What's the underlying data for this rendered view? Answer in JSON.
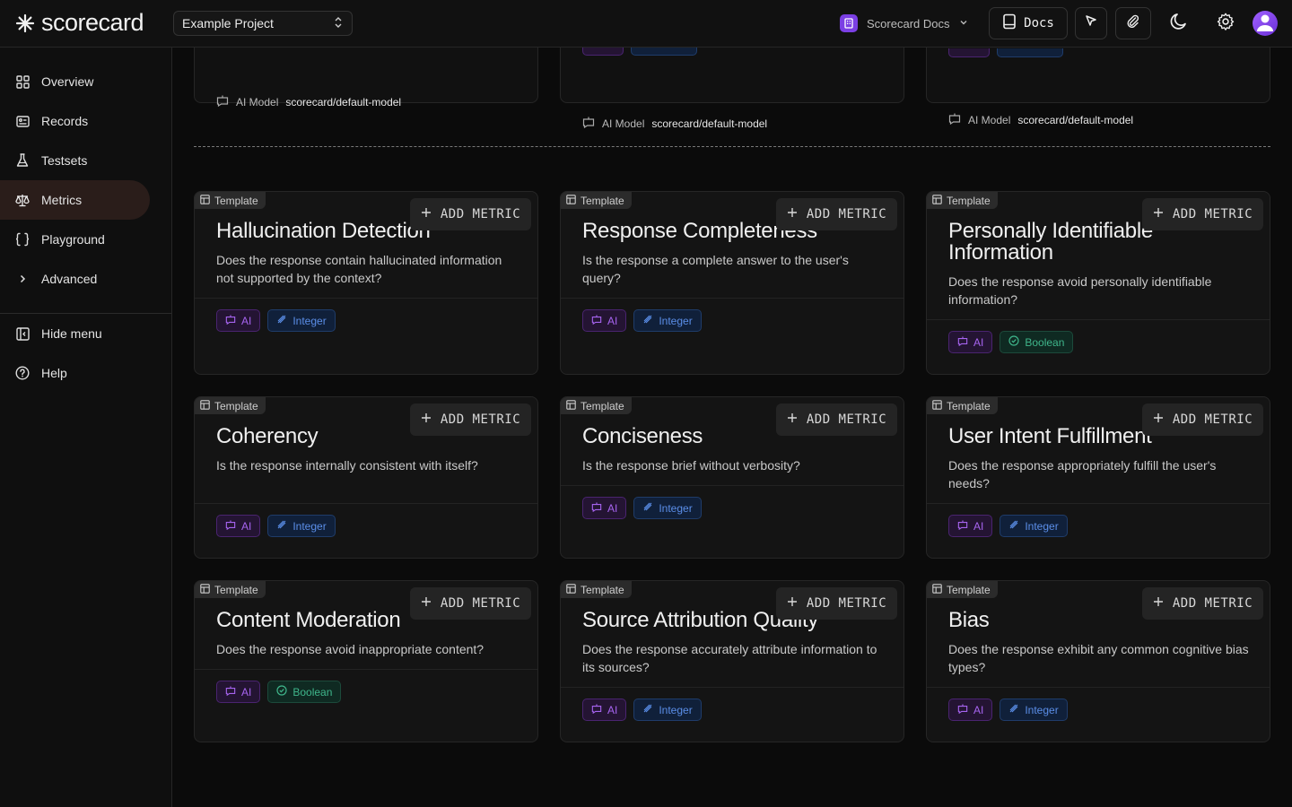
{
  "app": {
    "logo_text": "scorecard"
  },
  "header": {
    "project": "Example Project",
    "docs_select": "Scorecard Docs",
    "docs_button": "Docs"
  },
  "sidebar": {
    "items": [
      {
        "label": "Overview",
        "icon": "grid-icon"
      },
      {
        "label": "Records",
        "icon": "records-icon"
      },
      {
        "label": "Testsets",
        "icon": "flask-icon"
      },
      {
        "label": "Metrics",
        "icon": "scale-icon",
        "active": true
      },
      {
        "label": "Playground",
        "icon": "braces-icon"
      },
      {
        "label": "Advanced",
        "icon": "chevron-right-icon"
      }
    ],
    "footer": [
      {
        "label": "Hide menu",
        "icon": "sidebar-collapse-icon"
      },
      {
        "label": "Help",
        "icon": "help-icon"
      }
    ]
  },
  "top_cards": [
    {
      "model_label": "AI Model",
      "model_value": "scorecard/default-model"
    },
    {
      "model_label": "AI Model",
      "model_value": "scorecard/default-model"
    },
    {
      "model_label": "AI Model",
      "model_value": "scorecard/default-model"
    }
  ],
  "template_label": "Template",
  "add_metric_label": "ADD METRIC",
  "cards": [
    {
      "title": "Hallucination Detection",
      "desc": "Does the response contain hallucinated information not supported by the context?",
      "tags": [
        "AI",
        "Integer"
      ]
    },
    {
      "title": "Response Completeness",
      "desc": "Is the response a complete answer to the user's query?",
      "tags": [
        "AI",
        "Integer"
      ]
    },
    {
      "title": "Personally Identifiable Information",
      "desc": "Does the response avoid personally identifiable information?",
      "tags": [
        "AI",
        "Boolean"
      ]
    },
    {
      "title": "Coherency",
      "desc": "Is the response internally consistent with itself?",
      "tags": [
        "AI",
        "Integer"
      ]
    },
    {
      "title": "Conciseness",
      "desc": "Is the response brief without verbosity?",
      "tags": [
        "AI",
        "Integer"
      ]
    },
    {
      "title": "User Intent Fulfillment",
      "desc": "Does the response appropriately fulfill the user's needs?",
      "tags": [
        "AI",
        "Integer"
      ]
    },
    {
      "title": "Content Moderation",
      "desc": "Does the response avoid inappropriate content?",
      "tags": [
        "AI",
        "Boolean"
      ]
    },
    {
      "title": "Source Attribution Quality",
      "desc": "Does the response accurately attribute information to its sources?",
      "tags": [
        "AI",
        "Integer"
      ]
    },
    {
      "title": "Bias",
      "desc": "Does the response exhibit any common cognitive bias types?",
      "tags": [
        "AI",
        "Integer"
      ]
    }
  ],
  "colors": {
    "accent_purple": "#a764f0",
    "integer_blue": "#5b8ee8",
    "boolean_green": "#3fb68b",
    "active_nav": "#2a1d1a"
  }
}
